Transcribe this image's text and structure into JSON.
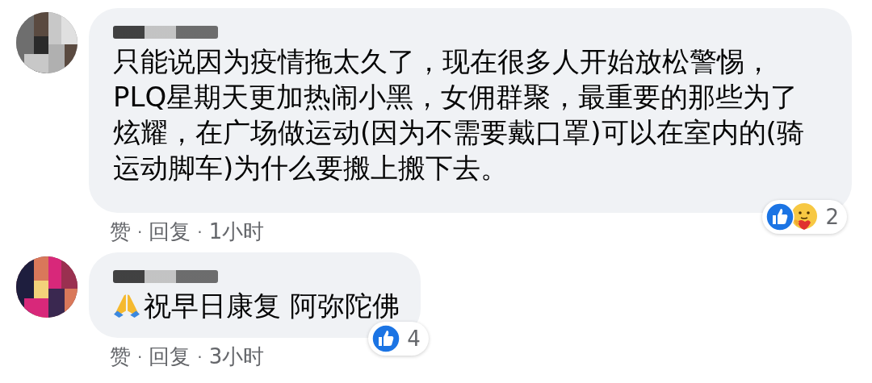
{
  "comments": [
    {
      "text": "只能说因为疫情拖太久了，现在很多人开始放松警惕，PLQ星期天更加热闹小黑，女佣群聚，最重要的那些为了炫耀，在广场做运动(因为不需要戴口罩)可以在室内的(骑运动脚车)为什么要搬上搬下去。",
      "reactions": [
        {
          "kind": "like"
        },
        {
          "kind": "care"
        }
      ],
      "reaction_count": "2",
      "actions": [
        {
          "kind": "link",
          "label": "赞"
        },
        {
          "kind": "separator",
          "label": "·"
        },
        {
          "kind": "link",
          "label": "回复"
        },
        {
          "kind": "separator",
          "label": "·"
        },
        {
          "kind": "time",
          "label": "1小时"
        }
      ]
    },
    {
      "emoji": {
        "kind": "pray"
      },
      "text": "祝早日康复 阿弥陀佛",
      "reactions": [
        {
          "kind": "like"
        }
      ],
      "reaction_count": "4",
      "actions": [
        {
          "kind": "link",
          "label": "赞"
        },
        {
          "kind": "separator",
          "label": "·"
        },
        {
          "kind": "link",
          "label": "回复"
        },
        {
          "kind": "separator",
          "label": "·"
        },
        {
          "kind": "time",
          "label": "3小时"
        }
      ]
    }
  ]
}
